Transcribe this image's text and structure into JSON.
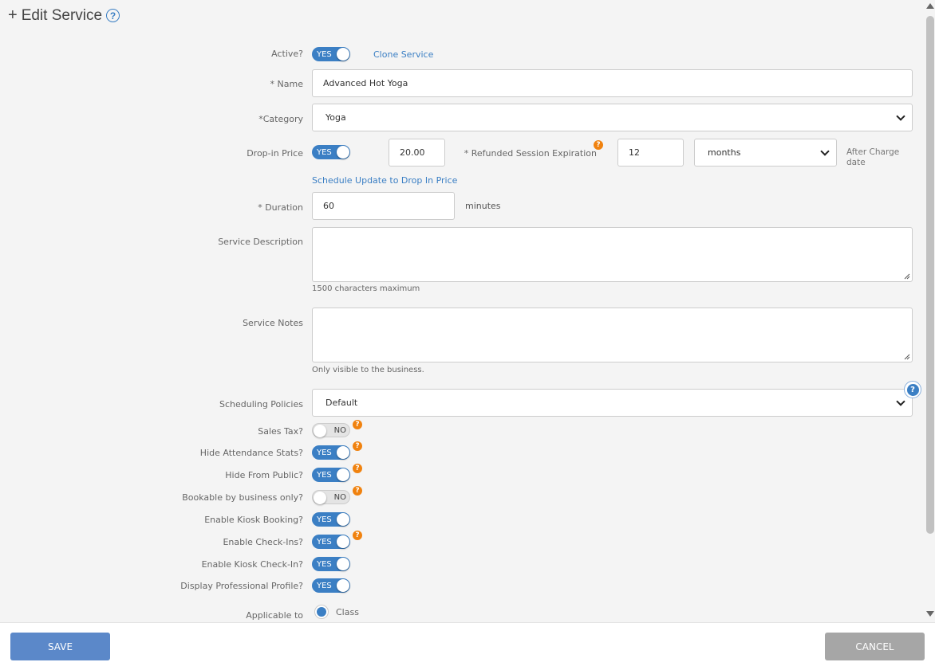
{
  "header": {
    "plus": "+",
    "title": "Edit Service",
    "help": "?"
  },
  "active": {
    "label": "Active?",
    "toggle": "YES",
    "clone_link": "Clone Service"
  },
  "name": {
    "label": "* Name",
    "value": "Advanced Hot Yoga"
  },
  "category": {
    "label": "*Category",
    "value": "Yoga"
  },
  "dropin": {
    "label": "Drop-in Price",
    "toggle": "YES",
    "price": "20.00",
    "refund_label": "* Refunded Session Expiration",
    "refund_value": "12",
    "unit": "months",
    "after_charge": "After Charge date",
    "schedule_link": "Schedule Update to Drop In Price"
  },
  "duration": {
    "label": "* Duration",
    "value": "60",
    "unit": "minutes"
  },
  "description": {
    "label": "Service Description",
    "hint": "1500 characters maximum"
  },
  "notes": {
    "label": "Service Notes",
    "hint": "Only visible to the business."
  },
  "scheduling": {
    "label": "Scheduling Policies",
    "value": "Default"
  },
  "toggles": [
    {
      "label": "Sales Tax?",
      "value": "NO"
    },
    {
      "label": "Hide Attendance Stats?",
      "value": "YES"
    },
    {
      "label": "Hide From Public?",
      "value": "YES"
    },
    {
      "label": "Bookable by business only?",
      "value": "NO"
    },
    {
      "label": "Enable Kiosk Booking?",
      "value": "YES"
    },
    {
      "label": "Enable Check-Ins?",
      "value": "YES"
    },
    {
      "label": "Enable Kiosk Check-In?",
      "value": "YES"
    },
    {
      "label": "Display Professional Profile?",
      "value": "YES"
    }
  ],
  "applicable": {
    "label": "Applicable to",
    "option": "Class"
  },
  "footer": {
    "save": "SAVE",
    "cancel": "CANCEL"
  },
  "colors": {
    "accent": "#3b7fc4",
    "badge": "#f0820f",
    "save_button": "#5b88c9",
    "cancel_button": "#a6a6a6"
  }
}
